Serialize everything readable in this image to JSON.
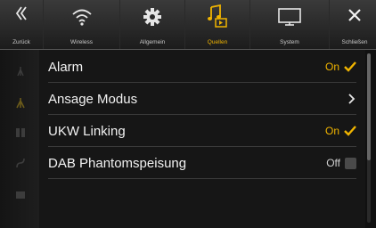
{
  "topbar": {
    "back_label": "Zurück",
    "tabs": [
      {
        "label": "Wireless",
        "icon": "wifi-icon"
      },
      {
        "label": "Allgemein",
        "icon": "gear-icon"
      },
      {
        "label": "Quellen",
        "icon": "music-source-icon",
        "active": true
      },
      {
        "label": "System",
        "icon": "monitor-icon"
      }
    ],
    "close_label": "Schließen"
  },
  "settings": [
    {
      "label": "Alarm",
      "state": "On",
      "checked": true
    },
    {
      "label": "Ansage Modus",
      "state": "",
      "chevron": true
    },
    {
      "label": "UKW Linking",
      "state": "On",
      "checked": true
    },
    {
      "label": "DAB Phantomspeisung",
      "state": "Off",
      "checked": false
    }
  ],
  "colors": {
    "accent": "#f0b400",
    "background": "#161616"
  }
}
